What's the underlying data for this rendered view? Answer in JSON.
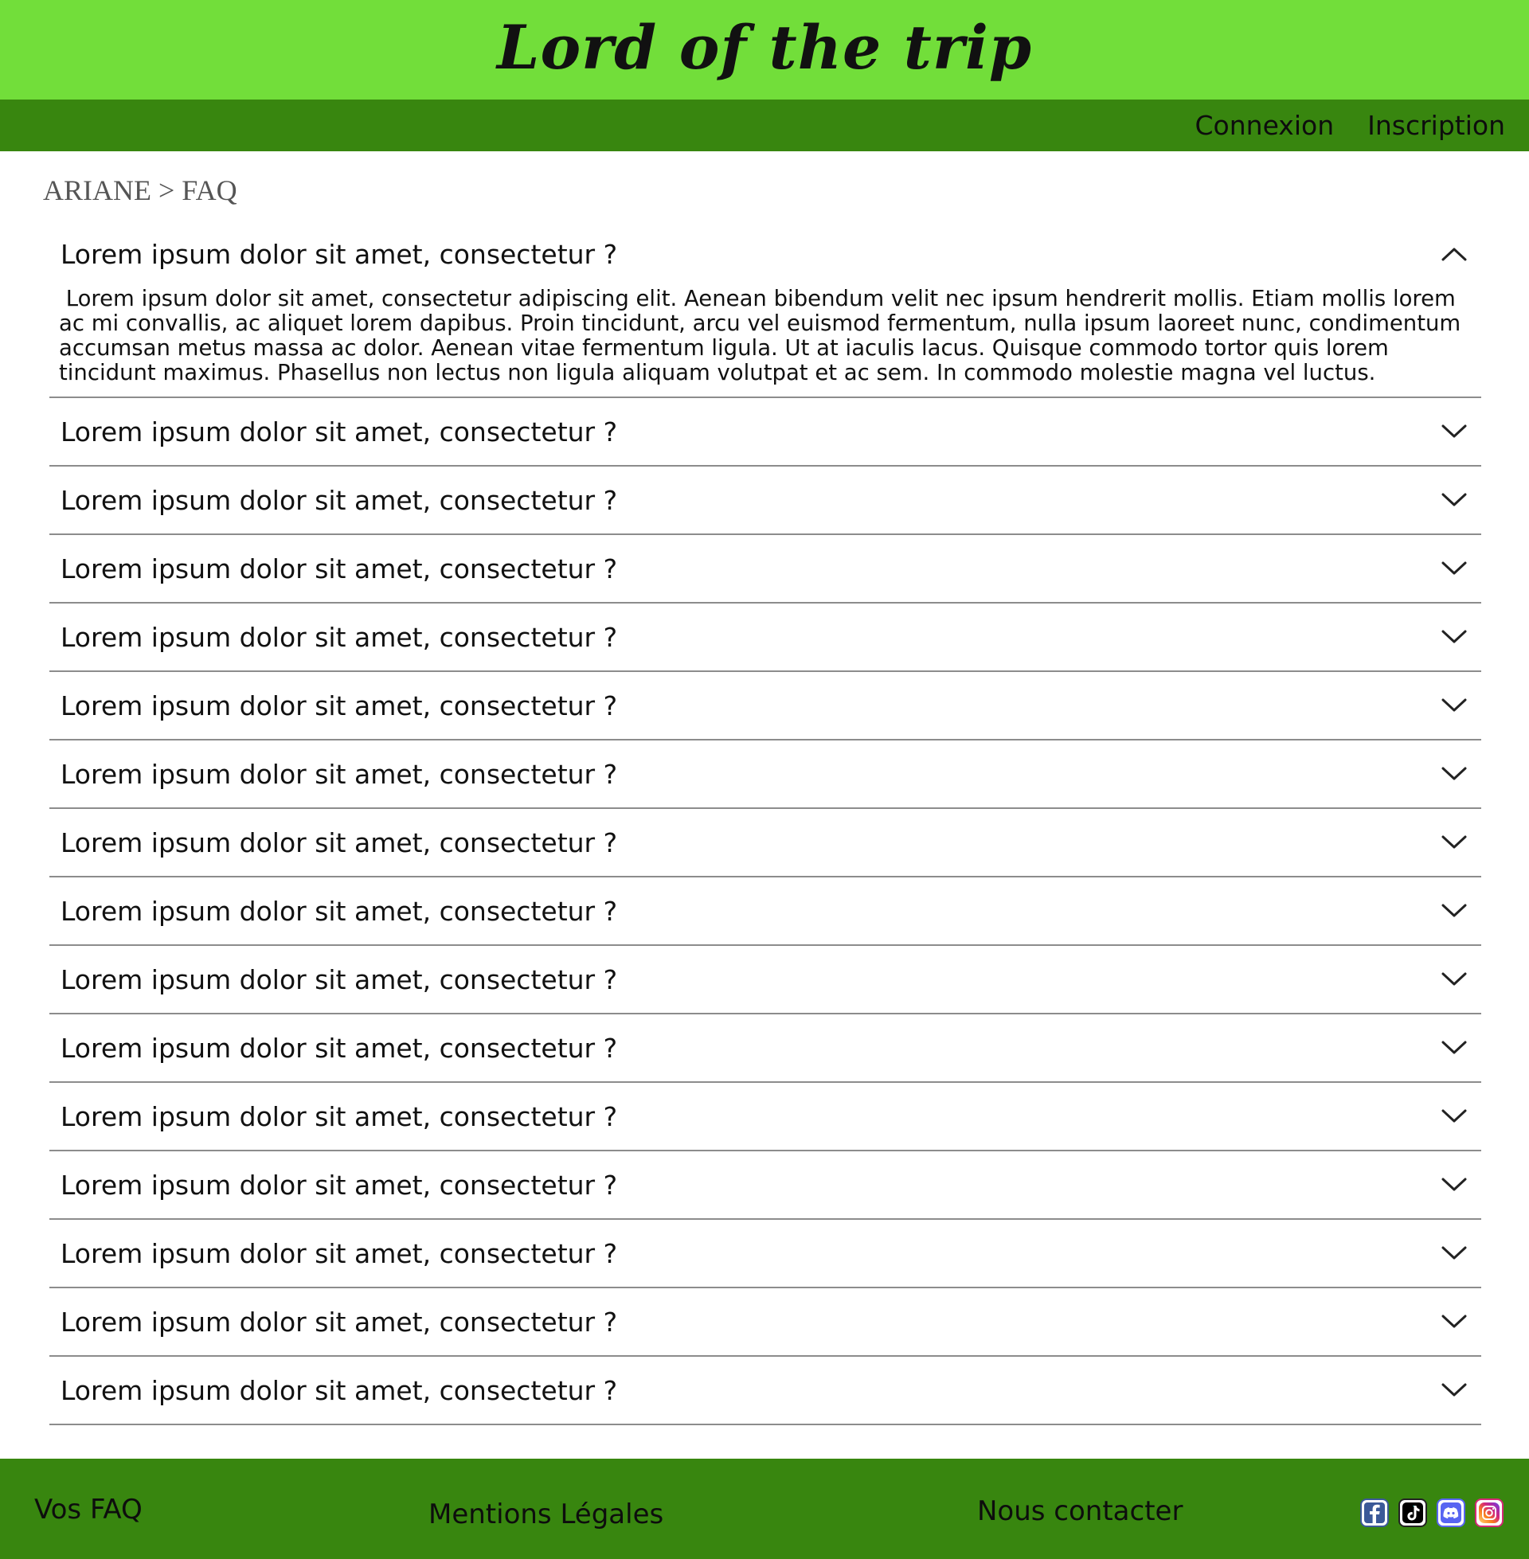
{
  "header": {
    "site_title": "Lord of the trip",
    "nav": {
      "login": "Connexion",
      "register": "Inscription"
    }
  },
  "breadcrumb": "ARIANE > FAQ",
  "faq": {
    "items": [
      {
        "question": "Lorem ipsum dolor sit amet, consectetur ?",
        "expanded": true,
        "answer": " Lorem ipsum dolor sit amet, consectetur adipiscing elit. Aenean bibendum velit nec ipsum hendrerit mollis. Etiam mollis lorem ac mi convallis, ac aliquet lorem dapibus. Proin tincidunt, arcu vel euismod fermentum, nulla ipsum laoreet nunc, condimentum accumsan metus massa ac dolor. Aenean vitae fermentum ligula. Ut at iaculis lacus. Quisque commodo tortor quis lorem tincidunt maximus. Phasellus non lectus non ligula aliquam volutpat et ac sem. In commodo molestie magna vel luctus."
      },
      {
        "question": "Lorem ipsum dolor sit amet, consectetur ?",
        "expanded": false
      },
      {
        "question": "Lorem ipsum dolor sit amet, consectetur ?",
        "expanded": false
      },
      {
        "question": "Lorem ipsum dolor sit amet, consectetur ?",
        "expanded": false
      },
      {
        "question": "Lorem ipsum dolor sit amet, consectetur ?",
        "expanded": false
      },
      {
        "question": "Lorem ipsum dolor sit amet, consectetur ?",
        "expanded": false
      },
      {
        "question": "Lorem ipsum dolor sit amet, consectetur ?",
        "expanded": false
      },
      {
        "question": "Lorem ipsum dolor sit amet, consectetur ?",
        "expanded": false
      },
      {
        "question": "Lorem ipsum dolor sit amet, consectetur ?",
        "expanded": false
      },
      {
        "question": "Lorem ipsum dolor sit amet, consectetur ?",
        "expanded": false
      },
      {
        "question": "Lorem ipsum dolor sit amet, consectetur ?",
        "expanded": false
      },
      {
        "question": "Lorem ipsum dolor sit amet, consectetur ?",
        "expanded": false
      },
      {
        "question": "Lorem ipsum dolor sit amet, consectetur ?",
        "expanded": false
      },
      {
        "question": "Lorem ipsum dolor sit amet, consectetur ?",
        "expanded": false
      },
      {
        "question": "Lorem ipsum dolor sit amet, consectetur ?",
        "expanded": false
      },
      {
        "question": "Lorem ipsum dolor sit amet, consectetur ?",
        "expanded": false
      }
    ]
  },
  "footer": {
    "faq": "Vos FAQ",
    "legal": "Mentions Légales",
    "contact": "Nous contacter",
    "socials": [
      {
        "icon": "facebook-icon",
        "color": "#3b5998"
      },
      {
        "icon": "tiktok-icon",
        "color": "#000000"
      },
      {
        "icon": "discord-icon",
        "color": "#5865f2"
      },
      {
        "icon": "instagram-icon",
        "color": "#e1306c"
      }
    ]
  },
  "colors": {
    "banner": "#72de3a",
    "nav": "#38860f",
    "divider": "#8c8c8c"
  }
}
